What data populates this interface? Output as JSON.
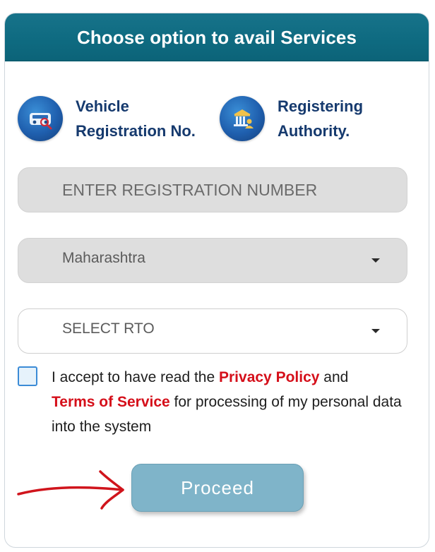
{
  "header": {
    "title": "Choose option to avail Services"
  },
  "options": [
    {
      "line1": "Vehicle",
      "line2": "Registration No.",
      "icon": "vehicle-registration-icon"
    },
    {
      "line1": "Registering",
      "line2": "Authority.",
      "icon": "registering-authority-icon"
    }
  ],
  "form": {
    "registration_placeholder": "ENTER REGISTRATION NUMBER",
    "state_value": "Maharashtra",
    "rto_value": "SELECT RTO"
  },
  "consent": {
    "text_before": "I accept to have read the ",
    "privacy_link": "Privacy Policy",
    "text_middle": " and ",
    "terms_link": "Terms of Service",
    "text_after": " for processing of my personal data into the system"
  },
  "proceed_label": "Proceed",
  "colors": {
    "header": "#0e6a80",
    "link": "#d50f1a",
    "option_text": "#163a6e",
    "button": "#7fb4c9",
    "annotation_arrow": "#d0141c"
  }
}
